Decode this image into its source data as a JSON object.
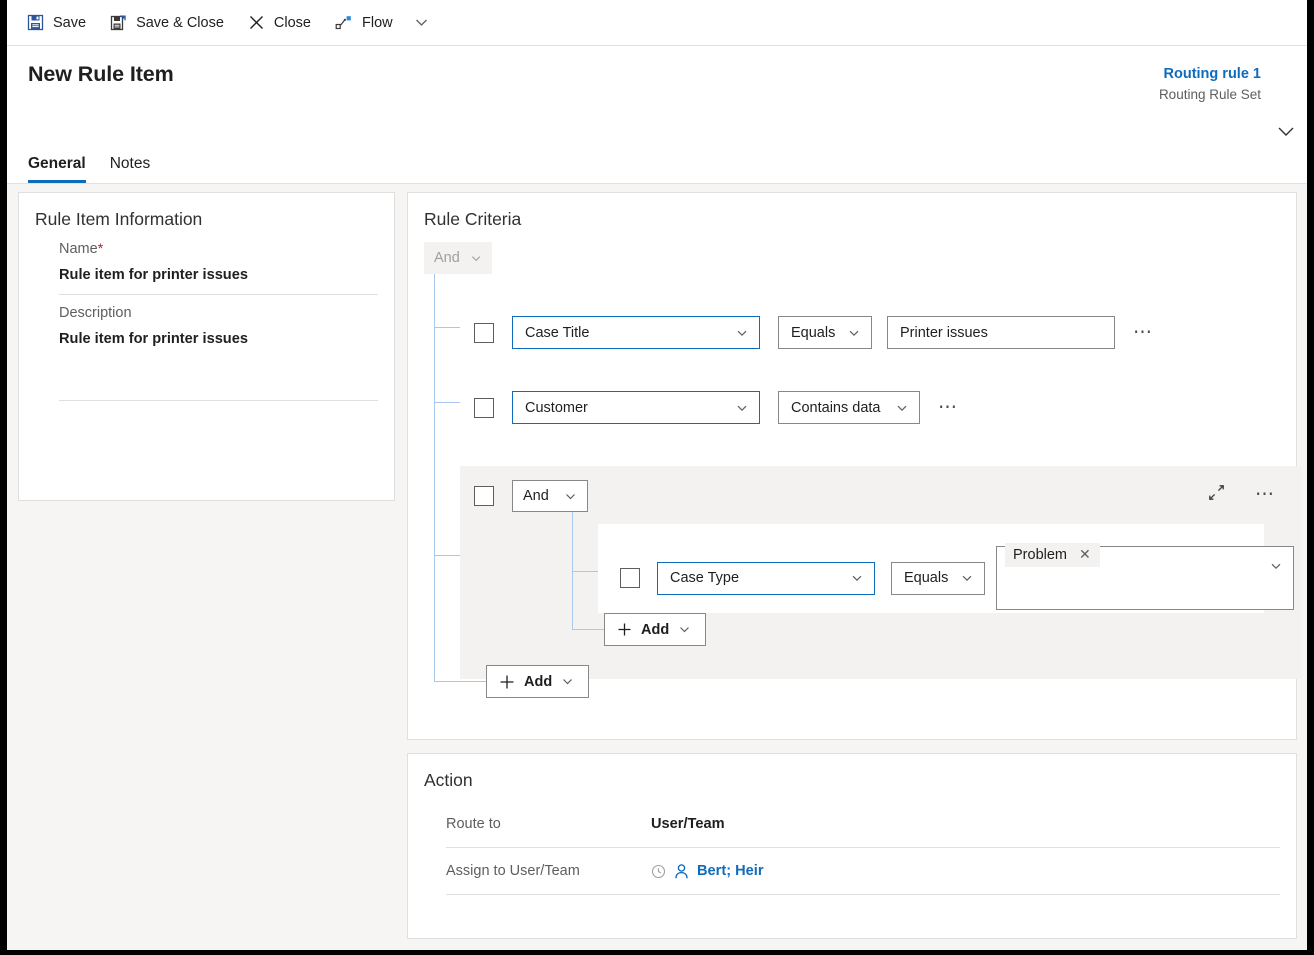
{
  "commandbar": {
    "items": [
      {
        "label": "Save",
        "icon": "save-icon"
      },
      {
        "label": "Save & Close",
        "icon": "save-and-close-icon"
      },
      {
        "label": "Close",
        "icon": "close-x-icon"
      },
      {
        "label": "Flow",
        "icon": "flow-icon"
      }
    ],
    "overflow_icon": "chevron-down-icon"
  },
  "header": {
    "title": "New Rule Item",
    "rule_link": "Routing rule 1",
    "rule_subtitle": "Routing Rule Set",
    "collapse_icon": "chevron-down-icon",
    "tabs": [
      {
        "label": "General",
        "active": true
      },
      {
        "label": "Notes",
        "active": false
      }
    ]
  },
  "rule_item_information": {
    "title": "Rule Item Information",
    "name_label": "Name",
    "name_required_marker": "*",
    "name_value": "Rule item for printer issues",
    "description_label": "Description",
    "description_value": "Rule item for printer issues"
  },
  "rule_criteria": {
    "title": "Rule Criteria",
    "root_operator": "And",
    "root_operator_disabled": true,
    "rows": [
      {
        "attribute": "Case Title",
        "operator": "Equals",
        "value": "Printer issues",
        "more_icon": "ellipsis-icon",
        "checkbox_icon": "checkbox-unchecked-icon"
      },
      {
        "attribute": "Customer",
        "operator": "Contains data",
        "value": null,
        "more_icon": "ellipsis-icon",
        "checkbox_icon": "checkbox-unchecked-icon"
      }
    ],
    "group": {
      "operator": "And",
      "collapse_icon": "collapse-diagonal-icon",
      "more_icon": "ellipsis-icon",
      "checkbox_icon": "checkbox-unchecked-icon",
      "rows": [
        {
          "attribute": "Case Type",
          "operator": "Equals",
          "value_chip": "Problem",
          "chip_remove_icon": "close-x-icon",
          "more_icon": "ellipsis-icon",
          "checkbox_icon": "checkbox-unchecked-icon"
        }
      ],
      "add_label": "Add",
      "add_icon": "plus-icon",
      "add_chevron_icon": "chevron-down-icon"
    },
    "add_label": "Add",
    "add_icon": "plus-icon",
    "add_chevron_icon": "chevron-down-icon"
  },
  "action": {
    "title": "Action",
    "route_to_label": "Route to",
    "route_to_value": "User/Team",
    "assign_label": "Assign to User/Team",
    "assign_value": "Bert; Heir",
    "assign_recent_icon": "recent-clock-icon",
    "assign_person_icon": "person-icon"
  },
  "colors": {
    "accent": "#0f6cbd",
    "required": "#a4262c",
    "tree_line": "#a8c8ee",
    "page_bg": "#f6f5f4",
    "group_bg": "#f3f2f1"
  }
}
